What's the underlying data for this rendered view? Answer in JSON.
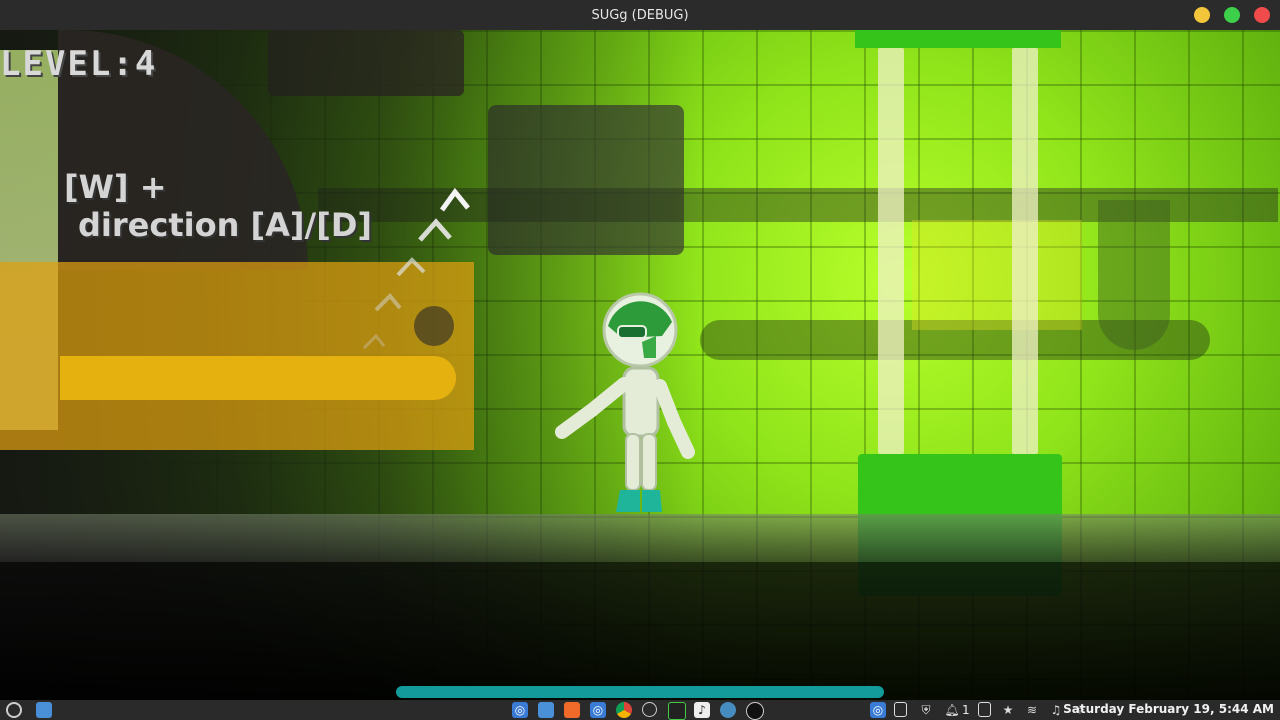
{
  "window": {
    "title": "SUGg (DEBUG)",
    "controls": {
      "minimize_color": "#f2c53a",
      "maximize_color": "#3ccf4a",
      "close_color": "#ef4b4b"
    }
  },
  "game": {
    "level_label": "LEVEL:4",
    "hint_line1": "[W] +",
    "hint_line2": "direction [A]/[D]",
    "accent_colors": {
      "bg_green": "#8fe41a",
      "yellow_panel": "#e0a010",
      "green_block": "#35c51a"
    }
  },
  "taskbar": {
    "menu_icon": "mint-menu-icon",
    "files_icon": "folder-icon",
    "app_icons": [
      "screenshot-icon",
      "files-icon",
      "brave-icon",
      "screenshot-icon",
      "chrome-icon",
      "clock-icon",
      "terminal-icon",
      "music-icon",
      "godot-icon",
      "game-icon"
    ],
    "tray_icons": [
      "screenshot-icon",
      "clipboard-icon",
      "shield-icon",
      "notifications-icon",
      "document-icon",
      "star-icon",
      "wifi-icon",
      "music-icon",
      "brightness-icon"
    ],
    "notification_count": "1",
    "clock": "Saturday February 19,  5:44 AM"
  }
}
